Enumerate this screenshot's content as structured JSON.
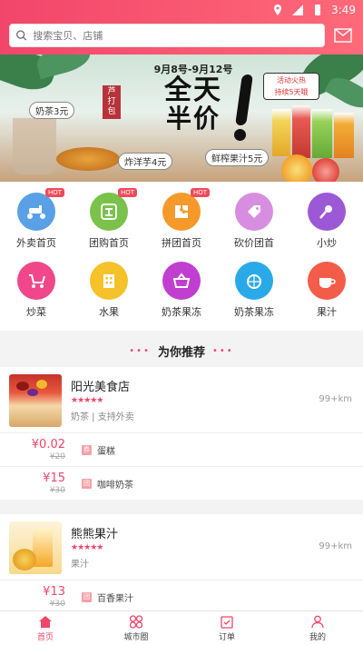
{
  "status_bar": {
    "time": "3:49"
  },
  "search": {
    "placeholder": "搜索宝贝、店铺"
  },
  "banner": {
    "dates": "9月8号-9月12号",
    "headline_1": "全天",
    "headline_2": "半价",
    "promo_badge": "芦打包",
    "event_box_line1": "活动火热",
    "event_box_line2": "持续5天哦",
    "tag_milk_tea": "奶茶3元",
    "tag_fries": "炸洋芋4元",
    "tag_juice": "鲜榨果汁5元"
  },
  "categories": [
    {
      "label": "外卖首页",
      "hot": "HOT",
      "color": "#5aa0e6"
    },
    {
      "label": "团购首页",
      "hot": "HOT",
      "color": "#7ac24a"
    },
    {
      "label": "拼团首页",
      "hot": "HOT",
      "color": "#f59a2a"
    },
    {
      "label": "砍价团首",
      "color": "#d88ee0"
    },
    {
      "label": "小炒",
      "color": "#9b59d6"
    },
    {
      "label": "炒菜",
      "color": "#f0478a"
    },
    {
      "label": "水果",
      "color": "#f5c22a"
    },
    {
      "label": "奶茶果冻",
      "color": "#c13fd0"
    },
    {
      "label": "奶茶果冻",
      "color": "#2aa9e8"
    },
    {
      "label": "果汁",
      "color": "#f45c4a"
    }
  ],
  "recommend": {
    "title": "为你推荐",
    "dots": "•••"
  },
  "stores": [
    {
      "name": "阳光美食店",
      "stars": "★★★★★",
      "desc": "奶茶 | 支持外卖",
      "distance": "99+km",
      "deals": [
        {
          "price": "¥0.02",
          "old": "¥20",
          "tag": "券",
          "name": "蛋糕"
        },
        {
          "price": "¥15",
          "old": "¥30",
          "tag": "团",
          "name": "咖啡奶茶"
        }
      ]
    },
    {
      "name": "熊熊果汁",
      "stars": "★★★★★",
      "desc": "果汁",
      "distance": "99+km",
      "deals": [
        {
          "price": "¥13",
          "old": "¥30",
          "tag": "团",
          "name": "百香果汁"
        }
      ]
    }
  ],
  "nav": [
    {
      "label": "首页",
      "icon": "home-icon"
    },
    {
      "label": "城市圈",
      "icon": "grid-icon"
    },
    {
      "label": "订单",
      "icon": "order-icon"
    },
    {
      "label": "我的",
      "icon": "user-icon"
    }
  ],
  "colors": {
    "accent": "#f2456a"
  }
}
